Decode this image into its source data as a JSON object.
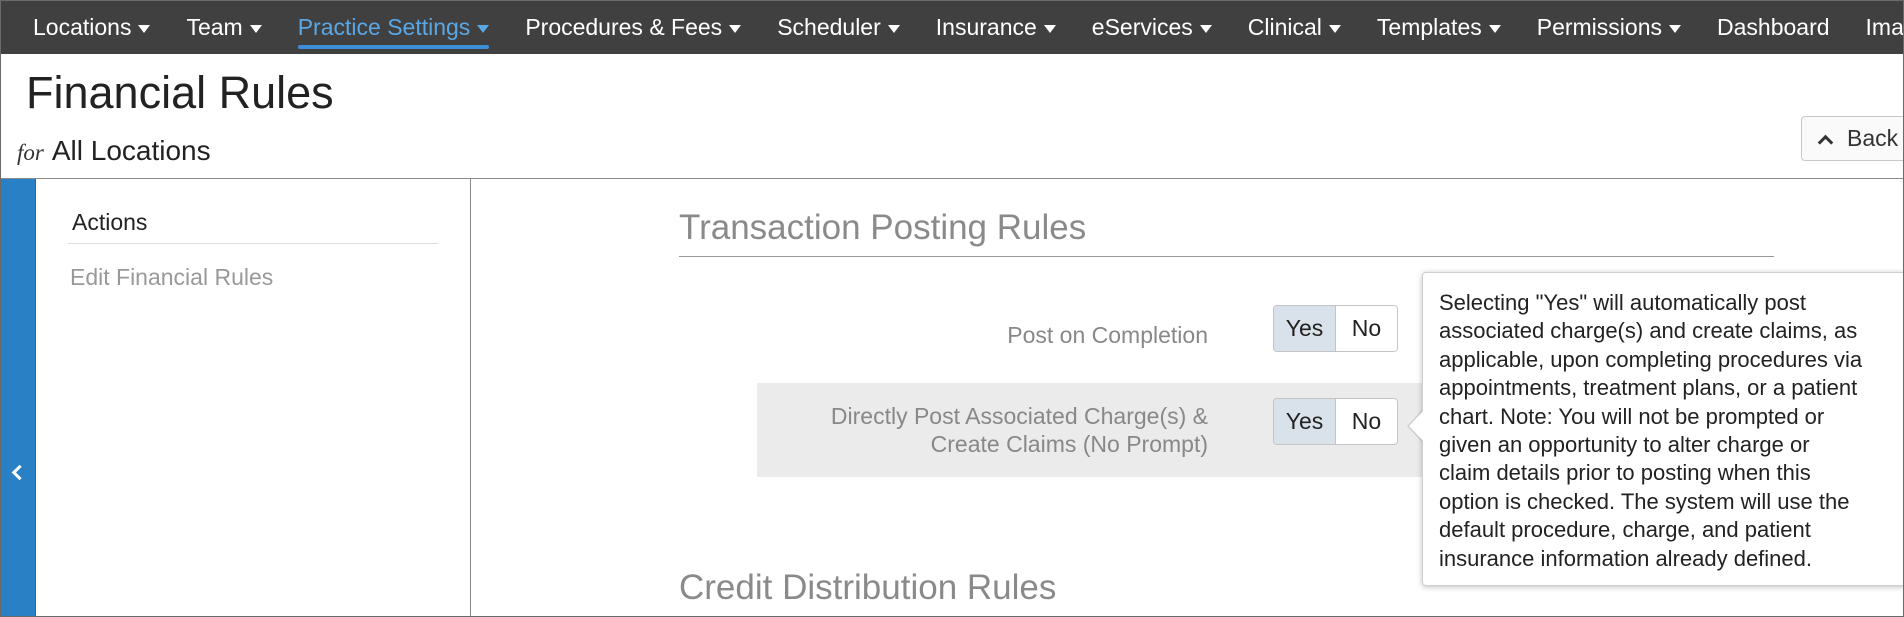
{
  "nav": {
    "items": [
      {
        "label": "Locations",
        "has_caret": true
      },
      {
        "label": "Team",
        "has_caret": true
      },
      {
        "label": "Practice Settings",
        "has_caret": true,
        "active": true
      },
      {
        "label": "Procedures & Fees",
        "has_caret": true
      },
      {
        "label": "Scheduler",
        "has_caret": true
      },
      {
        "label": "Insurance",
        "has_caret": true
      },
      {
        "label": "eServices",
        "has_caret": true
      },
      {
        "label": "Clinical",
        "has_caret": true
      },
      {
        "label": "Templates",
        "has_caret": true
      },
      {
        "label": "Permissions",
        "has_caret": true
      },
      {
        "label": "Dashboard",
        "has_caret": false
      },
      {
        "label": "Imagi",
        "has_caret": false
      }
    ]
  },
  "header": {
    "title": "Financial Rules",
    "for_label": "for",
    "location": "All Locations",
    "back_label": "Back"
  },
  "sidebar": {
    "heading": "Actions",
    "link": "Edit Financial Rules"
  },
  "main": {
    "section1_title": "Transaction Posting Rules",
    "section2_title": "Credit Distribution Rules",
    "rows": [
      {
        "label_line1": "Post on Completion",
        "label_line2": "",
        "yes": "Yes",
        "no": "No",
        "selected": "Yes"
      },
      {
        "label_line1": "Directly Post Associated Charge(s) &",
        "label_line2": "Create Claims (No Prompt)",
        "yes": "Yes",
        "no": "No",
        "selected": "Yes"
      }
    ]
  },
  "tooltip": {
    "lines": [
      "Selecting \"Yes\" will automatically post",
      "associated charge(s) and create claims, as",
      "applicable, upon completing procedures via",
      "appointments, treatment plans, or a patient",
      "chart. Note: You will not be prompted or",
      "given an opportunity to alter charge or",
      "claim details prior to posting when this",
      "option is checked. The system will use the",
      "default procedure, charge, and patient",
      "insurance information already defined."
    ]
  },
  "colors": {
    "nav_bg": "#404040",
    "nav_active": "#5aa7e6",
    "collapse_strip": "#2a80c4",
    "toggle_on": "#d9e2ea"
  },
  "icons": {
    "nav_caret": "caret-down-icon",
    "back": "chevron-up-icon",
    "collapse": "chevron-left-icon"
  }
}
